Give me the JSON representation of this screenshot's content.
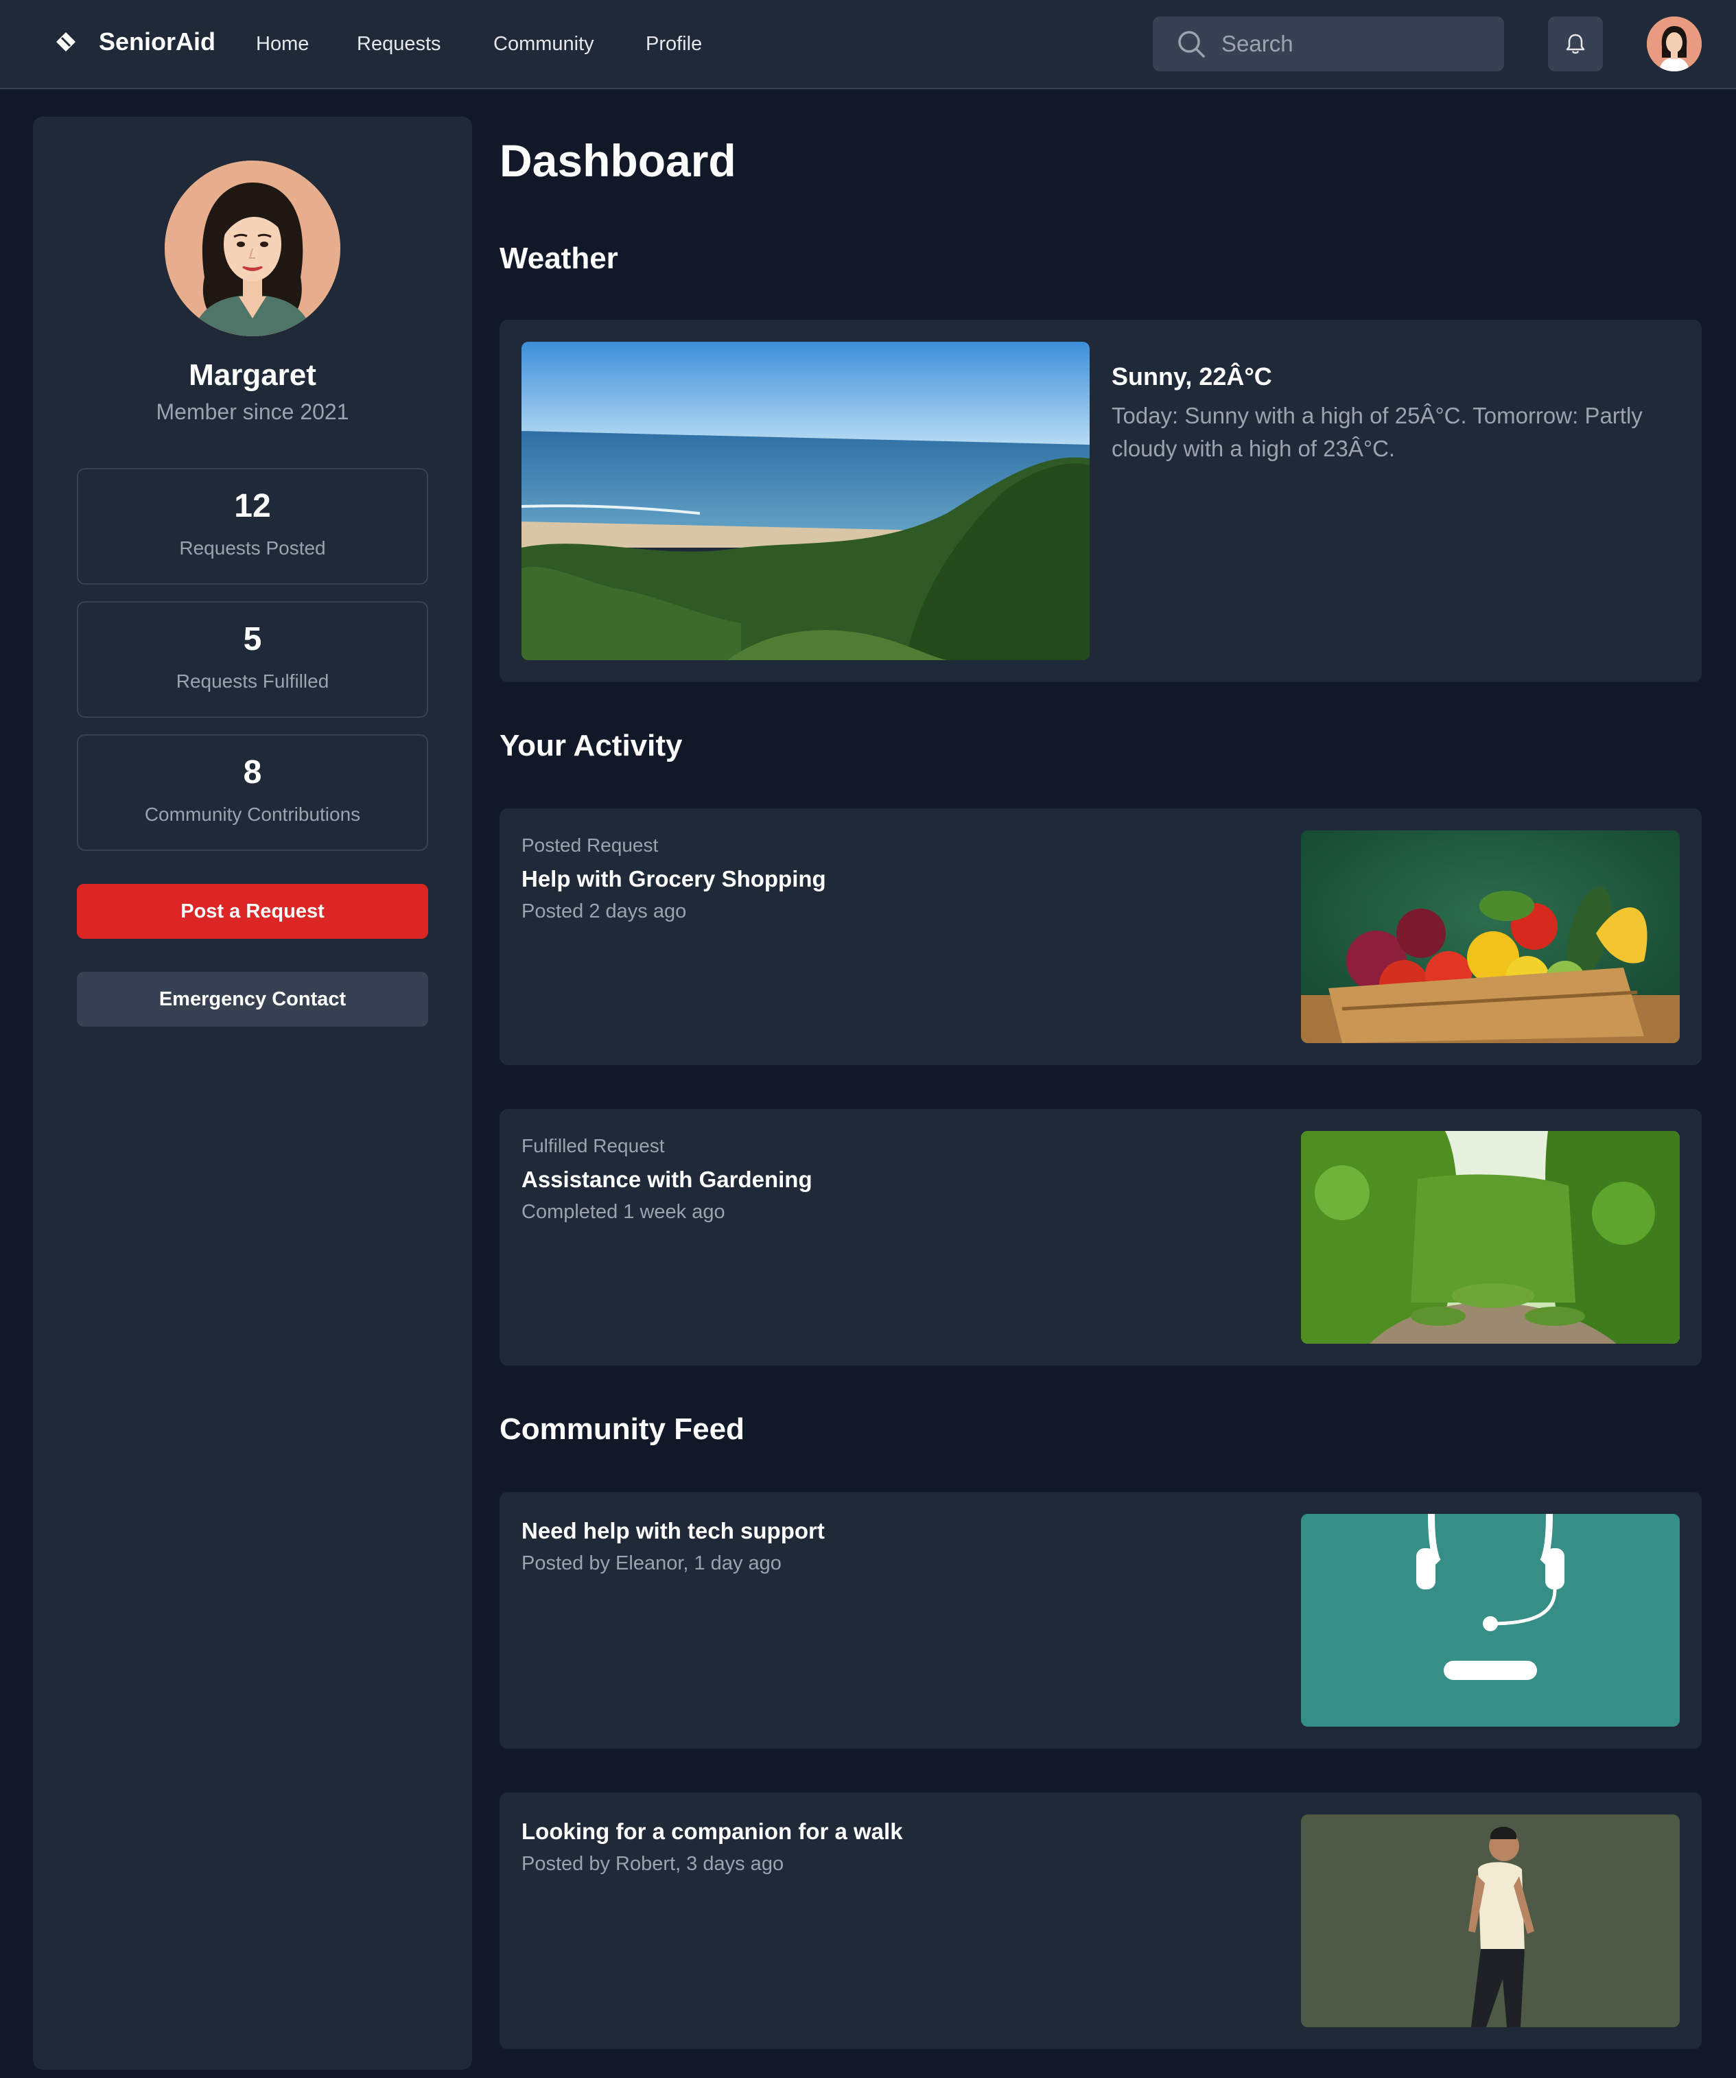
{
  "app": {
    "brand": "SeniorAid"
  },
  "nav": {
    "items": [
      {
        "label": "Home"
      },
      {
        "label": "Requests"
      },
      {
        "label": "Community"
      },
      {
        "label": "Profile"
      }
    ]
  },
  "search": {
    "placeholder": "Search"
  },
  "profile": {
    "name": "Margaret",
    "member_since": "Member since 2021",
    "stats": [
      {
        "value": "12",
        "label": "Requests Posted"
      },
      {
        "value": "5",
        "label": "Requests Fulfilled"
      },
      {
        "value": "8",
        "label": "Community Contributions"
      }
    ]
  },
  "actions": {
    "post_request": "Post a Request",
    "emergency_contact": "Emergency Contact"
  },
  "page": {
    "title": "Dashboard"
  },
  "weather": {
    "section_title": "Weather",
    "headline": "Sunny, 22Â°C",
    "description": "Today: Sunny with a high of 25Â°C. Tomorrow: Partly cloudy with a high of 23Â°C."
  },
  "activity": {
    "section_title": "Your Activity",
    "items": [
      {
        "kicker": "Posted Request",
        "title": "Help with Grocery Shopping",
        "meta": "Posted 2 days ago"
      },
      {
        "kicker": "Fulfilled Request",
        "title": "Assistance with Gardening",
        "meta": "Completed 1 week ago"
      }
    ]
  },
  "community": {
    "section_title": "Community Feed",
    "items": [
      {
        "title": "Need help with tech support",
        "meta": "Posted by Eleanor, 1 day ago"
      },
      {
        "title": "Looking for a companion for a walk",
        "meta": "Posted by Robert, 3 days ago"
      }
    ]
  },
  "colors": {
    "background": "#111827",
    "surface": "#1f2937",
    "border": "#374151",
    "accent_red": "#dc2626",
    "muted_text": "#9ca3af"
  },
  "icons": {
    "logo": "diamond-logo-icon",
    "search": "search-icon",
    "notifications": "bell-icon"
  }
}
